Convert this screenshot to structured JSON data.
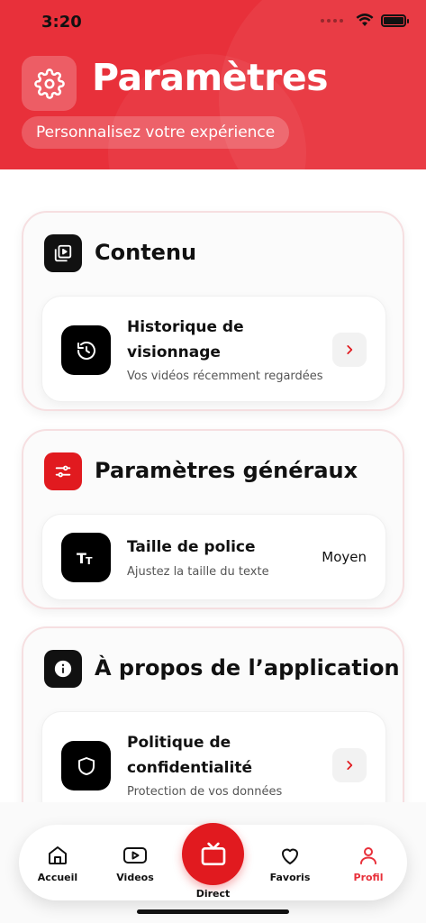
{
  "status": {
    "time": "3:20"
  },
  "header": {
    "title": "Paramètres",
    "subtitle": "Personnalisez votre expérience",
    "icon": "gear-icon",
    "color": "#e8303a"
  },
  "sections": [
    {
      "title": "Contenu",
      "icon": "video-library-icon",
      "icon_bg": "#111111",
      "items": [
        {
          "title": "Historique de visionnage",
          "subtitle": "Vos vidéos récemment regardées",
          "icon": "history-icon",
          "action": "chevron"
        }
      ]
    },
    {
      "title": "Paramètres généraux",
      "icon": "sliders-icon",
      "icon_bg": "#e11a1f",
      "items": [
        {
          "title": "Taille de police",
          "subtitle": "Ajustez la taille du texte",
          "icon": "text-size-icon",
          "value": "Moyen"
        }
      ]
    },
    {
      "title": "À propos de l’application",
      "icon": "info-icon",
      "icon_bg": "#111111",
      "items": [
        {
          "title": "Politique de confidentialité",
          "subtitle": "Protection de vos données",
          "icon": "shield-icon",
          "action": "chevron"
        }
      ]
    }
  ],
  "nav": {
    "items": [
      {
        "label": "Accueil",
        "icon": "home-icon",
        "active": false
      },
      {
        "label": "Videos",
        "icon": "play-icon",
        "active": false
      },
      {
        "label": "Direct",
        "icon": "tv-icon",
        "active": false
      },
      {
        "label": "Favoris",
        "icon": "heart-icon",
        "active": false
      },
      {
        "label": "Profil",
        "icon": "user-icon",
        "active": true
      }
    ],
    "active_color": "#e8303a"
  }
}
